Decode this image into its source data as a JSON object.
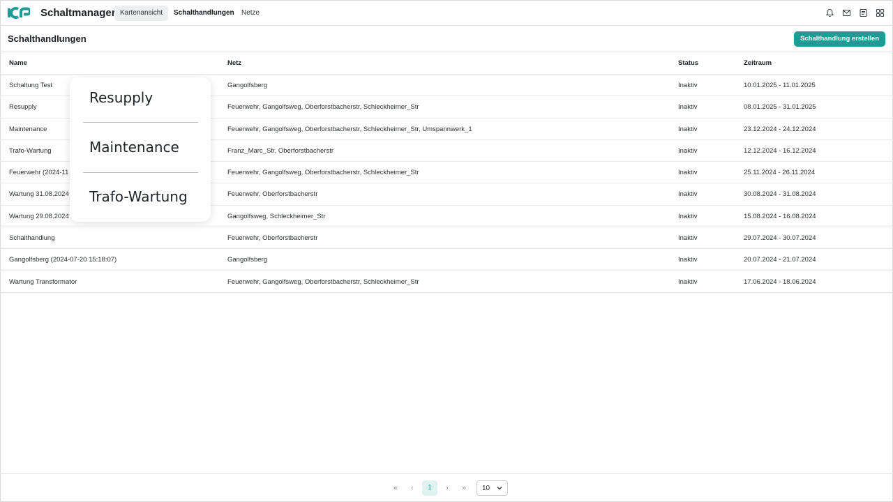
{
  "app": {
    "title": "Schaltmanager",
    "accent": "#1f9a95"
  },
  "nav": {
    "tabs": [
      {
        "label": "Kartenansicht"
      },
      {
        "label": "Schalthandlungen"
      },
      {
        "label": "Netze"
      }
    ],
    "icons": [
      "bell-icon",
      "mail-icon",
      "document-icon",
      "grid-apps-icon"
    ]
  },
  "header": {
    "title": "Schalthandlungen",
    "create_button": "Schalthandlung erstellen"
  },
  "table": {
    "columns": [
      "Name",
      "Netz",
      "Status",
      "Zeitraum"
    ],
    "rows": [
      {
        "name": "Schaltung Test",
        "netz": "Gangolfsberg",
        "status": "Inaktiv",
        "zeitraum": "10.01.2025 - 11.01.2025"
      },
      {
        "name": "Resupply",
        "netz": "Feuerwehr, Gangolfsweg, Oberforstbacherstr, Schleckheimer_Str",
        "status": "Inaktiv",
        "zeitraum": "08.01.2025 - 31.01.2025"
      },
      {
        "name": "Maintenance",
        "netz": "Feuerwehr, Gangolfsweg, Oberforstbacherstr, Schleckheimer_Str, Umspannwerk_1",
        "status": "Inaktiv",
        "zeitraum": "23.12.2024 - 24.12.2024"
      },
      {
        "name": "Trafo-Wartung",
        "netz": "Franz_Marc_Str, Oberforstbacherstr",
        "status": "Inaktiv",
        "zeitraum": "12.12.2024 - 16.12.2024"
      },
      {
        "name": "Feuerwehr (2024-11",
        "netz": "Feuerwehr, Gangolfsweg, Oberforstbacherstr, Schleckheimer_Str",
        "status": "Inaktiv",
        "zeitraum": "25.11.2024 - 26.11.2024"
      },
      {
        "name": "Wartung 31.08.2024",
        "netz": "Feuerwehr, Oberforstbacherstr",
        "status": "Inaktiv",
        "zeitraum": "30.08.2024 - 31.08.2024"
      },
      {
        "name": "Wartung 29.08.2024",
        "netz": "Gangolfsweg, Schleckheimer_Str",
        "status": "Inaktiv",
        "zeitraum": "15.08.2024 - 16.08.2024"
      },
      {
        "name": "Schalthandlung",
        "netz": "Feuerwehr, Oberforstbacherstr",
        "status": "Inaktiv",
        "zeitraum": "29.07.2024 - 30.07.2024"
      },
      {
        "name": "Gangolfsberg (2024-07-20 15:18:07)",
        "netz": "Gangolfsberg",
        "status": "Inaktiv",
        "zeitraum": "20.07.2024 - 21.07.2024"
      },
      {
        "name": "Wartung Transformator",
        "netz": "Feuerwehr, Gangolfsweg, Oberforstbacherstr, Schleckheimer_Str",
        "status": "Inaktiv",
        "zeitraum": "17.06.2024 - 18.06.2024"
      }
    ]
  },
  "popup": {
    "items": [
      "Resupply",
      "Maintenance",
      "Trafo-Wartung"
    ]
  },
  "pagination": {
    "first": "«",
    "prev": "‹",
    "current_page": "1",
    "next": "›",
    "last": "»",
    "page_size": "10"
  }
}
